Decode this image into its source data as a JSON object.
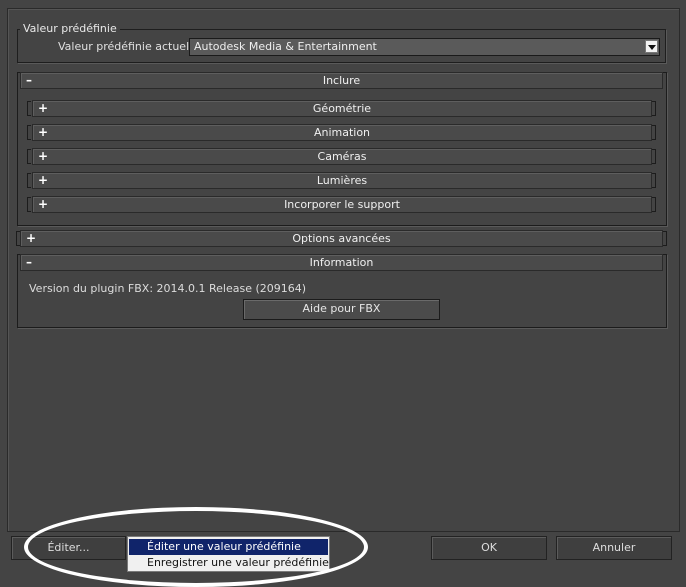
{
  "preset": {
    "group_title": "Valeur prédéfinie",
    "current_label": "Valeur prédéfinie actuelle:",
    "current_value": "Autodesk Media & Entertainment"
  },
  "include": {
    "title": "Inclure",
    "sign": "–",
    "items": [
      {
        "label": "Géométrie",
        "sign": "+"
      },
      {
        "label": "Animation",
        "sign": "+"
      },
      {
        "label": "Caméras",
        "sign": "+"
      },
      {
        "label": "Lumières",
        "sign": "+"
      },
      {
        "label": "Incorporer le support",
        "sign": "+"
      }
    ]
  },
  "advanced": {
    "title": "Options avancées",
    "sign": "+"
  },
  "information": {
    "title": "Information",
    "sign": "–",
    "version_text": "Version du plugin FBX: 2014.0.1 Release (209164)",
    "help_button": "Aide pour FBX"
  },
  "bottom": {
    "edit_button": "Éditer...",
    "ok_button": "OK",
    "cancel_button": "Annuler"
  },
  "edit_menu": {
    "items": [
      {
        "label": "Éditer une valeur prédéfinie",
        "selected": true
      },
      {
        "label": "Enregistrer une valeur prédéfinie",
        "selected": false
      }
    ]
  },
  "colors": {
    "background": "#444444",
    "menu_selection": "#10246a",
    "highlight_ellipse": "#ffffff"
  }
}
